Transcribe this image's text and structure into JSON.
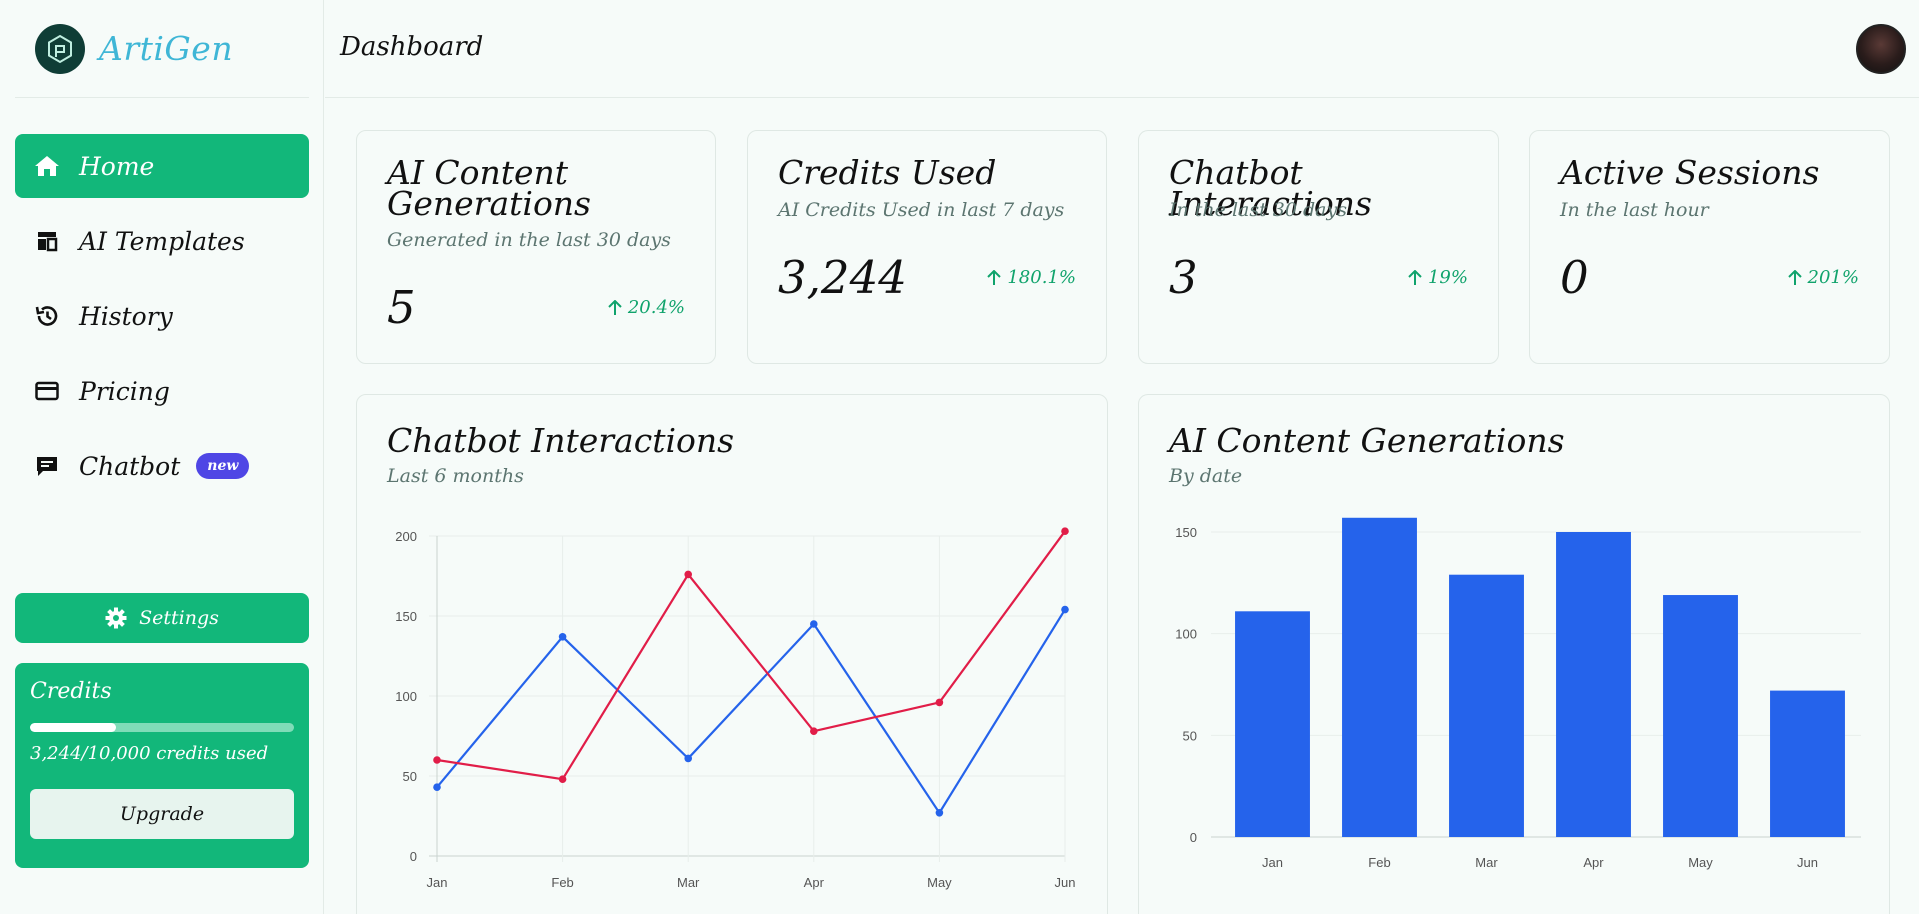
{
  "brand": {
    "name": "ArtiGen"
  },
  "sidebar": {
    "items": [
      {
        "label": "Home",
        "icon": "home-icon",
        "active": true
      },
      {
        "label": "AI Templates",
        "icon": "templates-icon"
      },
      {
        "label": "History",
        "icon": "history-icon"
      },
      {
        "label": "Pricing",
        "icon": "card-icon"
      },
      {
        "label": "Chatbot",
        "icon": "chat-icon",
        "badge": "new"
      }
    ],
    "settings_label": "Settings",
    "credits": {
      "title": "Credits",
      "used_text": "3,244/10,000 credits used",
      "used_fraction": 0.3244,
      "upgrade_label": "Upgrade"
    }
  },
  "header": {
    "title": "Dashboard"
  },
  "stats": [
    {
      "title": "AI Content Generations",
      "subtitle": "Generated in the last 30 days",
      "value": "5",
      "change": "20.4%"
    },
    {
      "title": "Credits Used",
      "subtitle": "AI Credits Used in last 7 days",
      "value": "3,244",
      "change": "180.1%"
    },
    {
      "title": "Chatbot Interactions",
      "subtitle": "In the last 30 days",
      "value": "3",
      "change": "19%"
    },
    {
      "title": "Active Sessions",
      "subtitle": "In the last hour",
      "value": "0",
      "change": "201%"
    }
  ],
  "charts": {
    "line": {
      "title": "Chatbot Interactions",
      "subtitle": "Last 6 months"
    },
    "bar": {
      "title": "AI Content Generations",
      "subtitle": "By date"
    }
  },
  "colors": {
    "accent": "#12b77a",
    "blue": "#2563eb",
    "red": "#e11d48",
    "badge": "#4f46e5"
  },
  "chart_data": [
    {
      "type": "line",
      "categories": [
        "Jan",
        "Feb",
        "Mar",
        "Apr",
        "May",
        "Jun"
      ],
      "ylim": [
        0,
        200
      ],
      "yticks": [
        0,
        50,
        100,
        150,
        200
      ],
      "series": [
        {
          "color": "#2563eb",
          "values": [
            43,
            137,
            61,
            145,
            27,
            154
          ]
        },
        {
          "color": "#e11d48",
          "values": [
            60,
            48,
            176,
            78,
            96,
            203
          ]
        }
      ],
      "grid": true
    },
    {
      "type": "bar",
      "categories": [
        "Jan",
        "Feb",
        "Mar",
        "Apr",
        "May",
        "Jun"
      ],
      "ylim": [
        0,
        150
      ],
      "yticks": [
        0,
        50,
        100,
        150
      ],
      "values": [
        111,
        157,
        129,
        150,
        119,
        72
      ],
      "color": "#2563eb",
      "grid": true
    }
  ]
}
